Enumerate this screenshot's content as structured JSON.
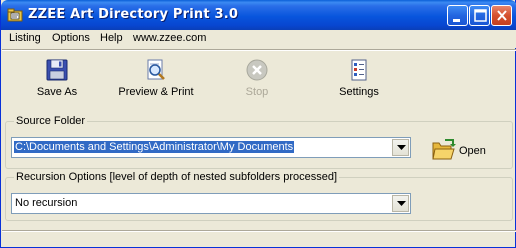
{
  "window": {
    "title": "ZZEE Art Directory Print 3.0",
    "accent": "#0855dd"
  },
  "menu": {
    "listing": "Listing",
    "options": "Options",
    "help": "Help",
    "website": "www.zzee.com"
  },
  "toolbar": {
    "save_as": "Save As",
    "preview_print": "Preview & Print",
    "stop": "Stop",
    "settings": "Settings"
  },
  "source_folder": {
    "legend": "Source Folder",
    "path": "C:\\Documents and Settings\\Administrator\\My Documents",
    "open_label": "Open"
  },
  "recursion": {
    "legend": "Recursion Options [level of depth of nested subfolders processed]",
    "value": "No recursion"
  },
  "icons": {
    "app": "app-folder-icon",
    "save": "floppy-disk-icon",
    "preview": "magnifier-page-icon",
    "stop": "stop-icon",
    "settings": "settings-checklist-icon",
    "open": "open-folder-icon"
  }
}
